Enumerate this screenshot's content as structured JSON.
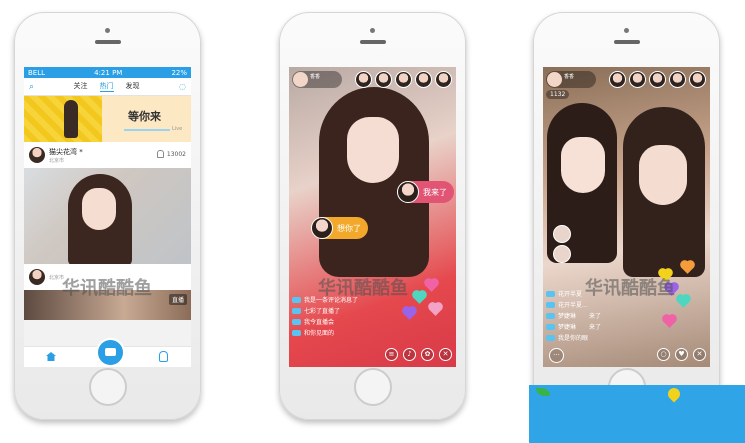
{
  "watermark": "华讯酷酷鱼",
  "phone1": {
    "status": {
      "carrier": "BELL",
      "time": "4:21 PM",
      "battery": "22%"
    },
    "tabs": [
      "关注",
      "热门",
      "发现"
    ],
    "active_tab": "热门",
    "banner_text": "等你来",
    "banner_tag": "Live",
    "cards": [
      {
        "name": "猫尖花湾 *",
        "location": "北京市",
        "viewers": "13002"
      },
      {
        "name": "",
        "location": "北京市",
        "viewers": ""
      }
    ],
    "live_badge": "直播",
    "accent": "#2b9fe6"
  },
  "phone2": {
    "host_name": "香香",
    "bubbles": [
      {
        "text": "我来了",
        "color": "#e25474"
      },
      {
        "text": "想你了",
        "color": "#f2a82a"
      }
    ],
    "chat_lines": [
      "我是一条评论消息了",
      "七彩了直播了",
      "我今直播会",
      "和你见面的"
    ],
    "controls": [
      "≡",
      "♪",
      "✿",
      "✕"
    ]
  },
  "phone3": {
    "host_name": "香香",
    "count": "1132",
    "chat_lines": [
      "花开半夏",
      "花开半夏...",
      "梦婕琳",
      "梦婕琳",
      "我是你的眼"
    ],
    "chat_tail": [
      "",
      "",
      "来了",
      "来了",
      ""
    ],
    "controls": [
      "○",
      "♥",
      "✕"
    ]
  }
}
